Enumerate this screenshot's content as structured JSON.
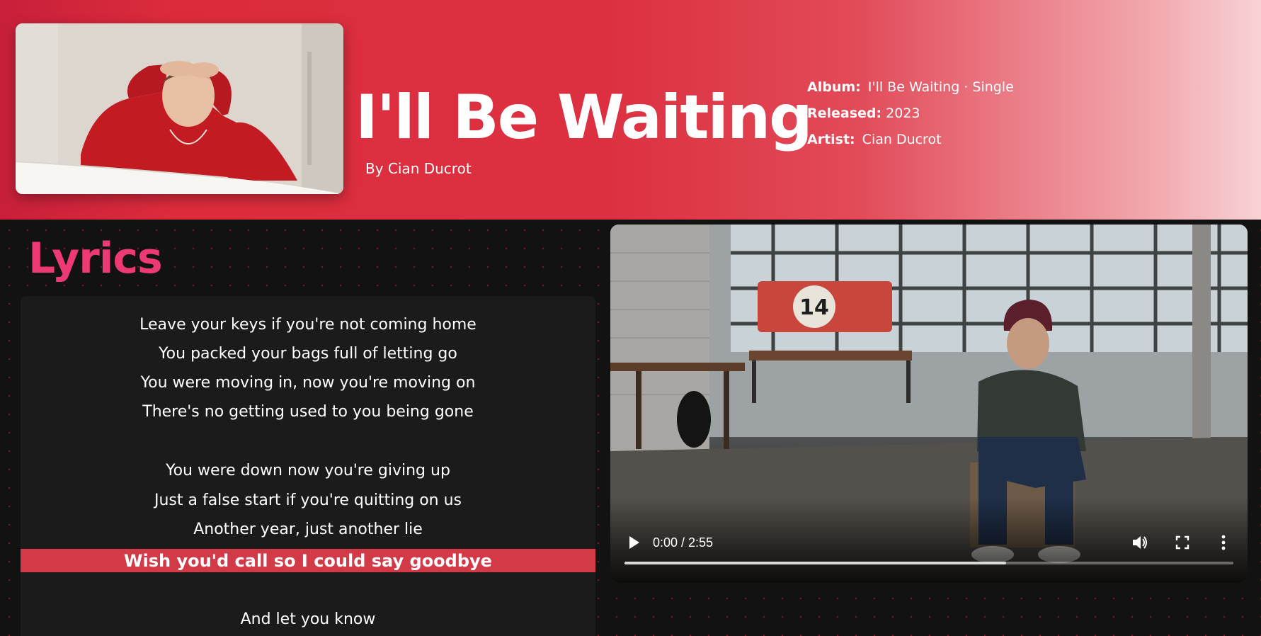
{
  "song": {
    "title": "I'll Be Waiting",
    "byline": "By Cian Ducrot",
    "cover_alt": "Cian Ducrot in a red sweater with hands on his head"
  },
  "meta": {
    "album_label": "Album:",
    "album_value": "I'll Be Waiting · Single",
    "released_label": "Released:",
    "released_value": "2023",
    "artist_label": "Artist:",
    "artist_value": "Cian Ducrot"
  },
  "lyrics": {
    "heading": "Lyrics",
    "lines": [
      "Leave your keys if you're not coming home",
      "You packed your bags full of letting go",
      "You were moving in, now you're moving on",
      "There's no getting used to you being gone",
      "",
      "You were down now you're giving up",
      "Just a false start if you're quitting on us",
      "Another year, just another lie",
      "Wish you'd call so I could say goodbye",
      "",
      "And let you know"
    ],
    "active_index": 8
  },
  "video": {
    "time": "0:00 / 2:55",
    "buffered_fraction": 0.627,
    "icons": {
      "play": "play-icon",
      "volume": "volume-icon",
      "fullscreen": "fullscreen-icon",
      "more": "more-vertical-icon"
    }
  },
  "colors": {
    "header_red": "#dc2c3c",
    "lyrics_heading": "#ee3a74",
    "active_line": "#d23a48",
    "panel": "#1b1b1b",
    "page_bg": "#121212"
  }
}
